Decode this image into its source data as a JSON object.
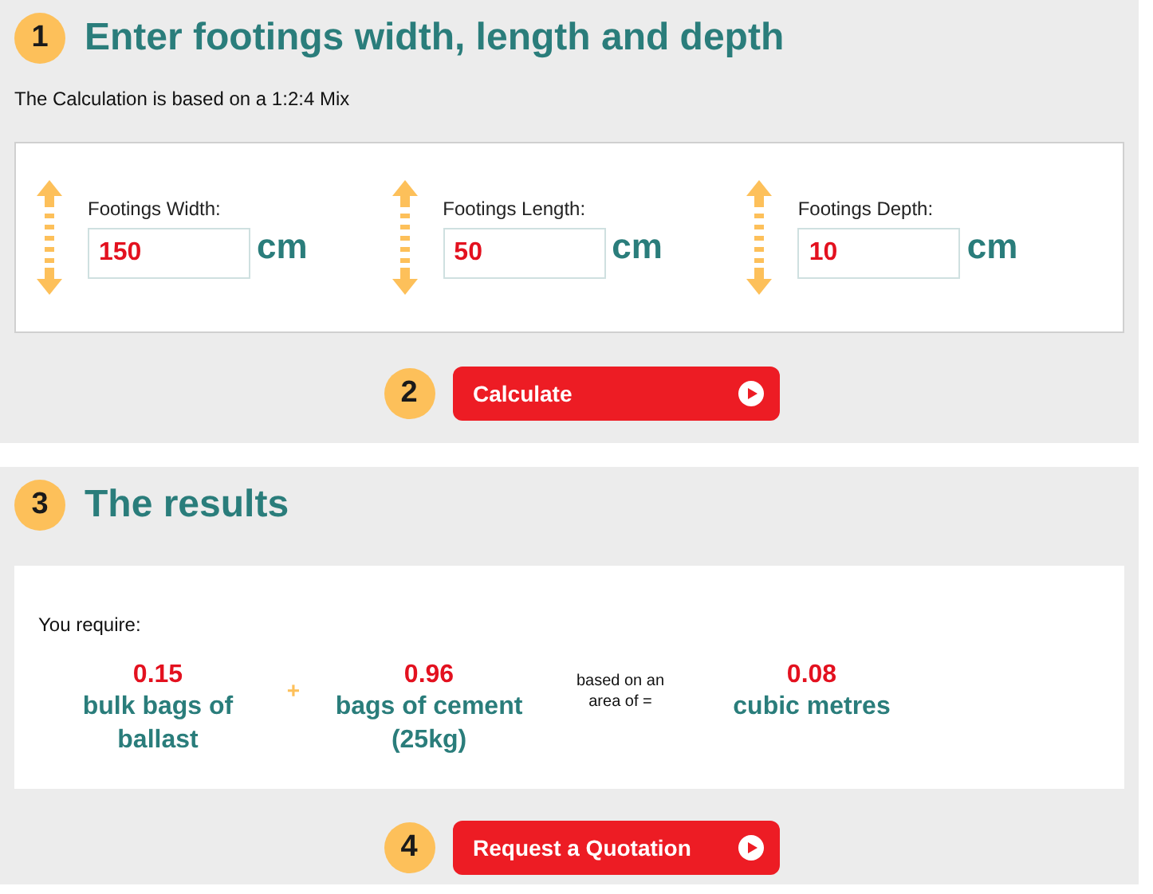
{
  "inputs_section": {
    "step": "1",
    "title": "Enter footings width, length and depth",
    "note": "The Calculation is based on a 1:2:4 Mix",
    "fields": [
      {
        "label": "Footings Width:",
        "value": "150",
        "unit": "cm"
      },
      {
        "label": "Footings Length:",
        "value": "50",
        "unit": "cm"
      },
      {
        "label": "Footings Depth:",
        "value": "10",
        "unit": "cm"
      }
    ],
    "action": {
      "step": "2",
      "label": "Calculate"
    }
  },
  "results_section": {
    "step": "3",
    "title": "The results",
    "intro": "You require:",
    "items": [
      {
        "kind": "quantity",
        "value": "0.15",
        "text": "bulk bags of ballast"
      },
      {
        "kind": "operator",
        "text": "+"
      },
      {
        "kind": "quantity",
        "value": "0.96",
        "text": "bags of cement (25kg)"
      },
      {
        "kind": "note",
        "text": "based on an area of ="
      },
      {
        "kind": "quantity",
        "value": "0.08",
        "text": "cubic metres"
      }
    ],
    "action": {
      "step": "4",
      "label": "Request a Quotation"
    }
  }
}
